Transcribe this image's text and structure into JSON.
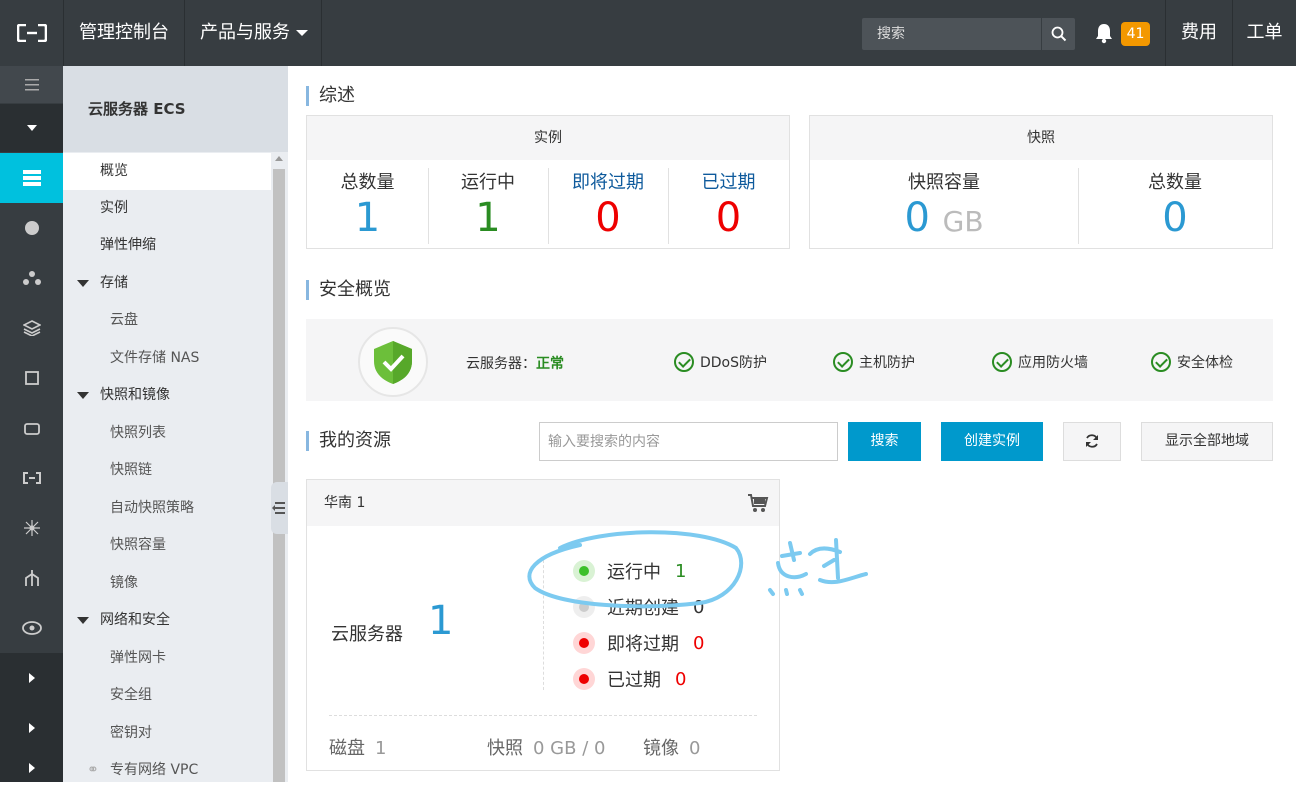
{
  "topbar": {
    "console": "管理控制台",
    "products": "产品与服务",
    "search_placeholder": "搜索",
    "notif_count": "41",
    "fee": "费用",
    "ticket": "工单"
  },
  "sidebar": {
    "title": "云服务器 ECS",
    "items": [
      {
        "label": "概览"
      },
      {
        "label": "实例"
      },
      {
        "label": "弹性伸缩"
      },
      {
        "label": "存储"
      },
      {
        "label": "云盘"
      },
      {
        "label": "文件存储 NAS"
      },
      {
        "label": "快照和镜像"
      },
      {
        "label": "快照列表"
      },
      {
        "label": "快照链"
      },
      {
        "label": "自动快照策略"
      },
      {
        "label": "快照容量"
      },
      {
        "label": "镜像"
      },
      {
        "label": "网络和安全"
      },
      {
        "label": "弹性网卡"
      },
      {
        "label": "安全组"
      },
      {
        "label": "密钥对"
      },
      {
        "label": "专有网络 VPC"
      }
    ]
  },
  "overview": {
    "title": "综述",
    "instances": {
      "header": "实例",
      "stats": [
        {
          "label": "总数量",
          "value": "1"
        },
        {
          "label": "运行中",
          "value": "1"
        },
        {
          "label": "即将过期",
          "value": "0"
        },
        {
          "label": "已过期",
          "value": "0"
        }
      ]
    },
    "snapshots": {
      "header": "快照",
      "capacity_label": "快照容量",
      "capacity_value": "0",
      "capacity_unit": "GB",
      "total_label": "总数量",
      "total_value": "0"
    }
  },
  "security": {
    "title": "安全概览",
    "ecs_label": "云服务器：",
    "ecs_status": "正常",
    "checks": [
      "DDoS防护",
      "主机防护",
      "应用防火墙",
      "安全体检"
    ]
  },
  "resources": {
    "title": "我的资源",
    "search_placeholder": "输入要搜索的内容",
    "search_btn": "搜索",
    "create_btn": "创建实例",
    "show_all_btn": "显示全部地域",
    "region": {
      "name": "华南 1",
      "ecs_label": "云服务器",
      "ecs_count": "1",
      "statuses": [
        {
          "label": "运行中",
          "value": "1"
        },
        {
          "label": "近期创建",
          "value": "0"
        },
        {
          "label": "即将过期",
          "value": "0"
        },
        {
          "label": "已过期",
          "value": "0"
        }
      ],
      "footer": {
        "disk_label": "磁盘",
        "disk_value": "1",
        "snapshot_label": "快照",
        "snapshot_value": "0 GB / 0",
        "image_label": "镜像",
        "image_value": "0"
      }
    }
  },
  "annotation": {
    "text": "点击",
    "color": "#7ccaf0"
  }
}
